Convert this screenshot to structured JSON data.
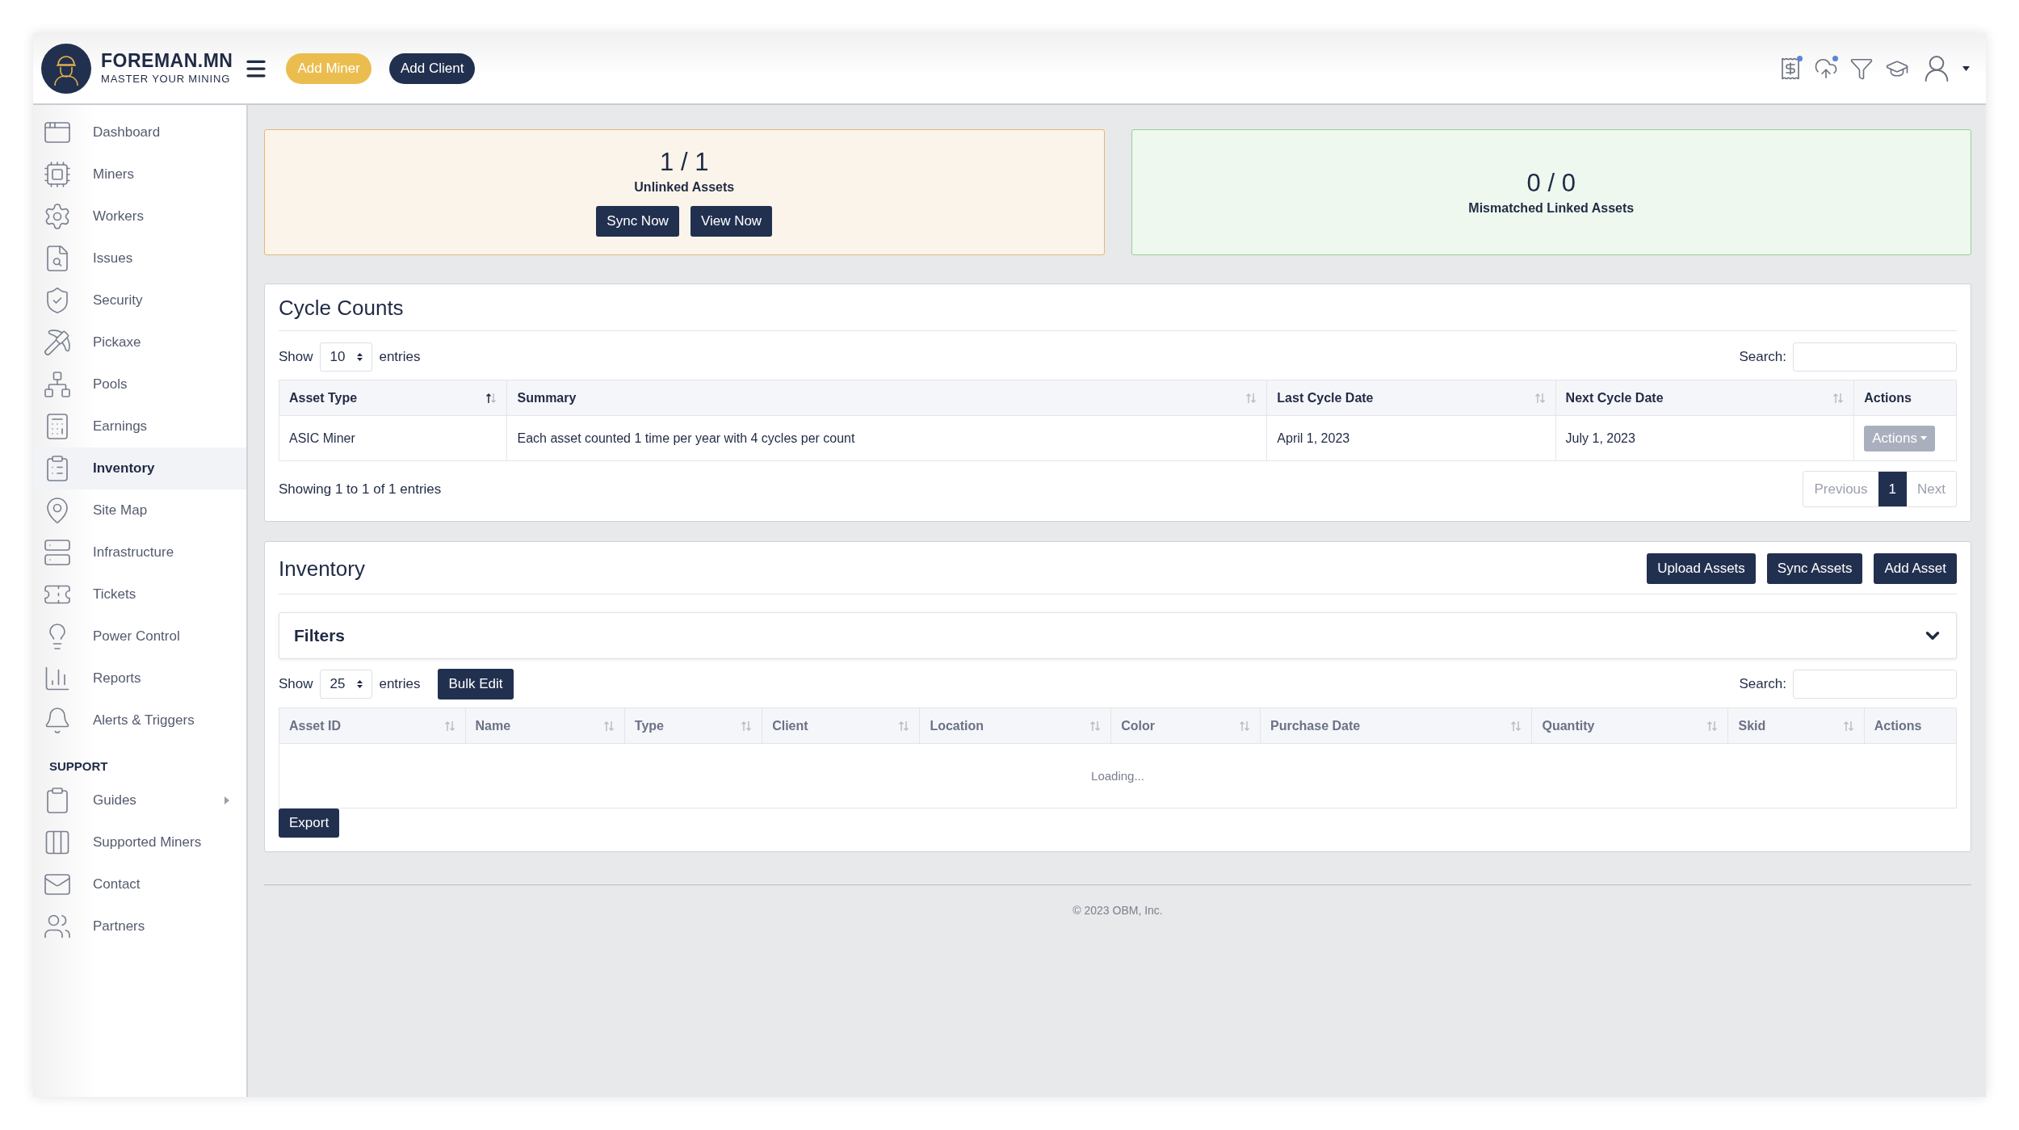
{
  "header": {
    "logo": {
      "title": "FOREMAN.MN",
      "subtitle": "MASTER YOUR MINING"
    },
    "buttons": [
      {
        "label": "Add Miner",
        "kind": "accent"
      },
      {
        "label": "Add Client",
        "kind": "primary"
      }
    ]
  },
  "sidebar": {
    "sections": [
      {
        "items": [
          {
            "label": "Dashboard",
            "selected": false
          },
          {
            "label": "Miners",
            "selected": false
          },
          {
            "label": "Workers",
            "selected": false
          },
          {
            "label": "Issues",
            "selected": false
          },
          {
            "label": "Security",
            "selected": false
          },
          {
            "label": "Pickaxe",
            "selected": false
          },
          {
            "label": "Pools",
            "selected": false
          },
          {
            "label": "Earnings",
            "selected": false
          },
          {
            "label": "Inventory",
            "selected": true
          },
          {
            "label": "Site Map",
            "selected": false
          },
          {
            "label": "Infrastructure",
            "selected": false
          },
          {
            "label": "Tickets",
            "selected": false
          },
          {
            "label": "Power Control",
            "selected": false
          },
          {
            "label": "Reports",
            "selected": false
          },
          {
            "label": "Alerts & Triggers",
            "selected": false
          }
        ]
      },
      {
        "heading": "SUPPORT",
        "items": [
          {
            "label": "Guides",
            "selected": false,
            "submenu": true
          },
          {
            "label": "Supported Miners",
            "selected": false
          },
          {
            "label": "Contact",
            "selected": false
          },
          {
            "label": "Partners",
            "selected": false
          }
        ]
      }
    ]
  },
  "summary_cards": [
    {
      "value": "1 / 1",
      "label": "Unlinked Assets",
      "color": "#e7b87a",
      "buttons": [
        "Sync Now",
        "View Now"
      ]
    },
    {
      "value": "0 / 0",
      "label": "Mismatched Linked Assets",
      "color": "#93d196"
    }
  ],
  "cycle_counts": {
    "title": "Cycle Counts",
    "length_menu": {
      "show": "Show",
      "value": "10",
      "entries": "entries"
    },
    "search_label": "Search:",
    "columns": [
      {
        "label": "Asset Type",
        "sortable": true,
        "sorted": true
      },
      {
        "label": "Summary",
        "sortable": true,
        "sorted": false
      },
      {
        "label": "Last Cycle Date",
        "sortable": true,
        "sorted": false
      },
      {
        "label": "Next Cycle Date",
        "sortable": true,
        "sorted": false
      },
      {
        "label": "Actions",
        "sortable": false
      }
    ],
    "rows": [
      {
        "cells": [
          "ASIC Miner",
          "Each asset counted 1 time per year with 4 cycles per count",
          "April 1, 2023",
          "July 1, 2023"
        ],
        "action": "Actions"
      }
    ],
    "info": "Showing 1 to 1 of 1 entries",
    "pagination": {
      "previous": {
        "label": "Previous",
        "disabled": true
      },
      "pages": [
        {
          "label": "1",
          "selected": true
        }
      ],
      "next": {
        "label": "Next",
        "disabled": true
      }
    }
  },
  "inventory": {
    "title": "Inventory",
    "buttons": [
      "Upload Assets",
      "Sync Assets",
      "Add Asset"
    ],
    "filters": {
      "title": "Filters",
      "expanded": false
    },
    "length_menu": {
      "show": "Show",
      "value": "25",
      "entries": "entries"
    },
    "bulk_edit": "Bulk Edit",
    "search_label": "Search:",
    "columns": [
      {
        "label": "Asset ID",
        "sortable": true,
        "sorted": false
      },
      {
        "label": "Name",
        "sortable": true,
        "sorted": false
      },
      {
        "label": "Type",
        "sortable": true,
        "sorted": false
      },
      {
        "label": "Client",
        "sortable": true,
        "sorted": false
      },
      {
        "label": "Location",
        "sortable": true,
        "sorted": false
      },
      {
        "label": "Color",
        "sortable": true,
        "sorted": false
      },
      {
        "label": "Purchase Date",
        "sortable": true,
        "sorted": false
      },
      {
        "label": "Quantity",
        "sortable": true,
        "sorted": false
      },
      {
        "label": "Skid",
        "sortable": true,
        "sorted": false
      },
      {
        "label": "Actions",
        "sortable": false
      }
    ],
    "loading": "Loading...",
    "export": "Export"
  },
  "footer": {
    "text": "© 2023 OBM, Inc."
  }
}
